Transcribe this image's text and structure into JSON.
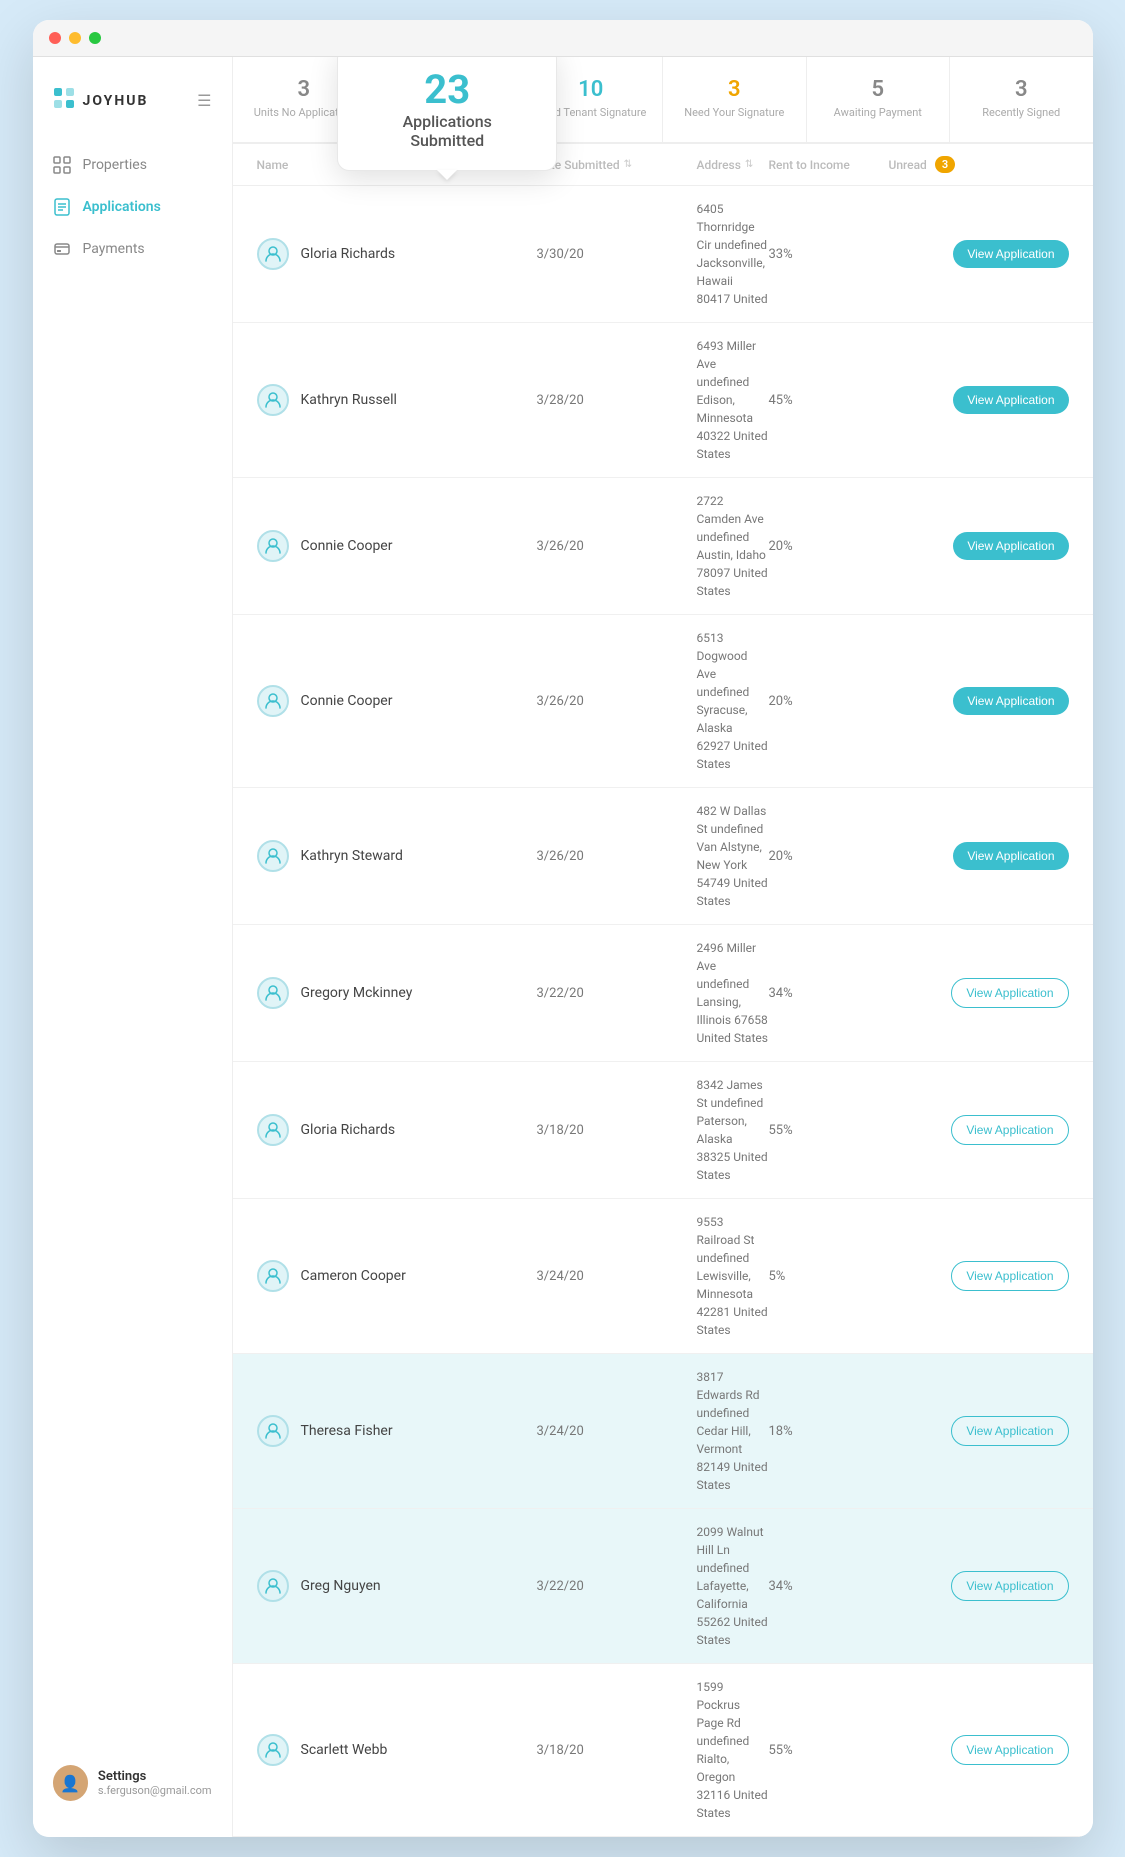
{
  "browser": {
    "dots": [
      "red",
      "yellow",
      "green"
    ]
  },
  "sidebar": {
    "logo": "JOYHUB",
    "logo_icon": "≣",
    "menu_icon": "☰",
    "nav_items": [
      {
        "id": "properties",
        "label": "Properties",
        "icon": "grid"
      },
      {
        "id": "applications",
        "label": "Applications",
        "icon": "doc",
        "active": true
      },
      {
        "id": "payments",
        "label": "Payments",
        "icon": "receipt"
      }
    ],
    "user": {
      "name": "Settings",
      "email": "s.ferguson@gmail.com"
    }
  },
  "stats": [
    {
      "id": "no-app",
      "number": "3",
      "label": "Units No Application",
      "active": false
    },
    {
      "id": "submitted",
      "number": "23",
      "label": "Applications Submitted",
      "active": true,
      "selected": true
    },
    {
      "id": "tenant-sig",
      "number": "10",
      "label": "Need Tenant Signature",
      "active": true
    },
    {
      "id": "your-sig",
      "number": "3",
      "label": "Need Your Signature",
      "active": true
    },
    {
      "id": "payment",
      "number": "5",
      "label": "Awaiting Payment",
      "active": false
    },
    {
      "id": "signed",
      "number": "3",
      "label": "Recently Signed",
      "active": false
    }
  ],
  "tooltip": {
    "number": "23",
    "label": "Applications Submitted"
  },
  "table": {
    "headers": {
      "name": "Name",
      "date": "Date Submitted",
      "address": "Address",
      "rti": "Rent to Income",
      "unread": "Unread",
      "unread_count": "3"
    },
    "rows": [
      {
        "name": "Gloria Richards",
        "date": "3/30/20",
        "address": "6405 Thornridge Cir undefined Jacksonville, Hawaii 80417 United",
        "rti": "33%",
        "btn_label": "View Application",
        "filled": true,
        "highlighted": false
      },
      {
        "name": "Kathryn Russell",
        "date": "3/28/20",
        "address": "6493 Miller Ave undefined Edison, Minnesota 40322 United States",
        "rti": "45%",
        "btn_label": "View Application",
        "filled": true,
        "highlighted": false
      },
      {
        "name": "Connie Cooper",
        "date": "3/26/20",
        "address": "2722 Camden Ave undefined Austin, Idaho 78097 United States",
        "rti": "20%",
        "btn_label": "View Application",
        "filled": true,
        "highlighted": false
      },
      {
        "name": "Connie Cooper",
        "date": "3/26/20",
        "address": "6513 Dogwood Ave undefined Syracuse, Alaska 62927 United States",
        "rti": "20%",
        "btn_label": "View Application",
        "filled": true,
        "highlighted": false
      },
      {
        "name": "Kathryn Steward",
        "date": "3/26/20",
        "address": "482 W Dallas St undefined Van Alstyne, New York 54749 United States",
        "rti": "20%",
        "btn_label": "View Application",
        "filled": true,
        "highlighted": false
      },
      {
        "name": "Gregory Mckinney",
        "date": "3/22/20",
        "address": "2496 Miller Ave undefined Lansing, Illinois 67658 United States",
        "rti": "34%",
        "btn_label": "View Application",
        "filled": false,
        "highlighted": false
      },
      {
        "name": "Gloria Richards",
        "date": "3/18/20",
        "address": "8342 James St undefined Paterson, Alaska 38325 United States",
        "rti": "55%",
        "btn_label": "View Application",
        "filled": false,
        "highlighted": false
      },
      {
        "name": "Cameron Cooper",
        "date": "3/24/20",
        "address": "9553 Railroad St undefined Lewisville, Minnesota 42281 United States",
        "rti": "5%",
        "btn_label": "View Application",
        "filled": false,
        "highlighted": false
      },
      {
        "name": "Theresa Fisher",
        "date": "3/24/20",
        "address": "3817 Edwards Rd undefined Cedar Hill, Vermont 82149 United States",
        "rti": "18%",
        "btn_label": "View Application",
        "filled": false,
        "highlighted": true
      },
      {
        "name": "Greg Nguyen",
        "date": "3/22/20",
        "address": "2099 Walnut Hill Ln undefined Lafayette, California 55262 United States",
        "rti": "34%",
        "btn_label": "View Application",
        "filled": false,
        "highlighted": true
      },
      {
        "name": "Scarlett Webb",
        "date": "3/18/20",
        "address": "1599 Pockrus Page Rd undefined Rialto, Oregon 32116 United States",
        "rti": "55%",
        "btn_label": "View Application",
        "filled": false,
        "highlighted": false
      }
    ]
  }
}
